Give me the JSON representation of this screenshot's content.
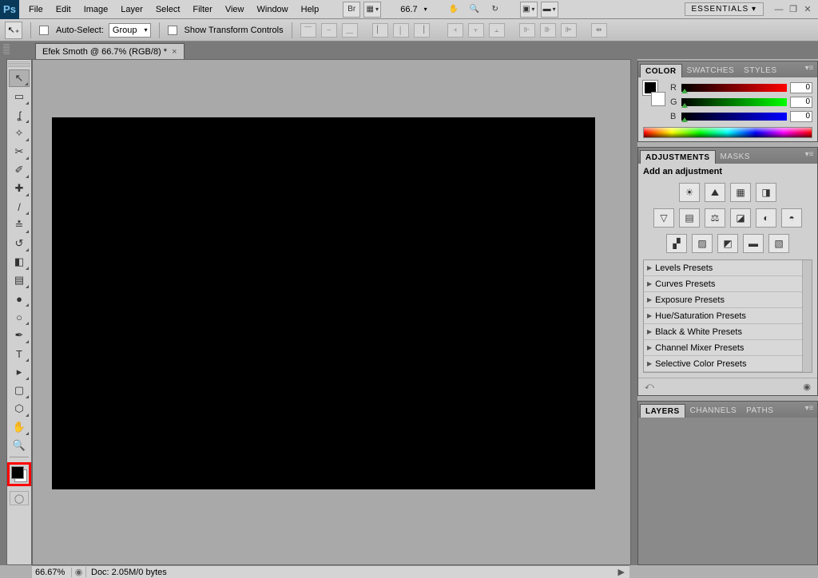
{
  "menubar": {
    "logo": "Ps",
    "items": [
      "File",
      "Edit",
      "Image",
      "Layer",
      "Select",
      "Filter",
      "View",
      "Window",
      "Help"
    ],
    "zoom_display": "66.7",
    "workspace_label": "ESSENTIALS ▾"
  },
  "options": {
    "auto_select_label": "Auto-Select:",
    "auto_select_value": "Group",
    "show_transform_label": "Show Transform Controls"
  },
  "document": {
    "tab_title": "Efek Smoth @ 66.7% (RGB/8) *"
  },
  "color_panel": {
    "tabs": [
      "COLOR",
      "SWATCHES",
      "STYLES"
    ],
    "channels": [
      {
        "label": "R",
        "value": "0",
        "track": "red"
      },
      {
        "label": "G",
        "value": "0",
        "track": "green"
      },
      {
        "label": "B",
        "value": "0",
        "track": "blue"
      }
    ]
  },
  "adjustments_panel": {
    "tabs": [
      "ADJUSTMENTS",
      "MASKS"
    ],
    "title": "Add an adjustment",
    "presets": [
      "Levels Presets",
      "Curves Presets",
      "Exposure Presets",
      "Hue/Saturation Presets",
      "Black & White Presets",
      "Channel Mixer Presets",
      "Selective Color Presets"
    ]
  },
  "layers_panel": {
    "tabs": [
      "LAYERS",
      "CHANNELS",
      "PATHS"
    ]
  },
  "status": {
    "zoom": "66.67%",
    "doc_info": "Doc: 2.05M/0 bytes"
  },
  "tools": [
    {
      "name": "move-tool",
      "glyph": "↖",
      "selected": true,
      "sub": true
    },
    {
      "name": "marquee-tool",
      "glyph": "▭",
      "sub": true
    },
    {
      "name": "lasso-tool",
      "glyph": "ʆ",
      "sub": true
    },
    {
      "name": "quick-select-tool",
      "glyph": "✧",
      "sub": true
    },
    {
      "name": "crop-tool",
      "glyph": "✂",
      "sub": true
    },
    {
      "name": "eyedropper-tool",
      "glyph": "✐",
      "sub": true
    },
    {
      "name": "healing-tool",
      "glyph": "✚",
      "sub": true
    },
    {
      "name": "brush-tool",
      "glyph": "/",
      "sub": true
    },
    {
      "name": "clone-stamp-tool",
      "glyph": "≛",
      "sub": true
    },
    {
      "name": "history-brush-tool",
      "glyph": "↺",
      "sub": true
    },
    {
      "name": "eraser-tool",
      "glyph": "◧",
      "sub": true
    },
    {
      "name": "gradient-tool",
      "glyph": "▤",
      "sub": true
    },
    {
      "name": "blur-tool",
      "glyph": "●",
      "sub": true
    },
    {
      "name": "dodge-tool",
      "glyph": "○",
      "sub": true
    },
    {
      "name": "pen-tool",
      "glyph": "✒",
      "sub": true
    },
    {
      "name": "type-tool",
      "glyph": "T",
      "sub": true
    },
    {
      "name": "path-select-tool",
      "glyph": "▸",
      "sub": true
    },
    {
      "name": "shape-tool",
      "glyph": "▢",
      "sub": true
    },
    {
      "name": "3d-tool",
      "glyph": "⬡",
      "sub": true
    },
    {
      "name": "hand-tool",
      "glyph": "✋",
      "sub": true
    },
    {
      "name": "zoom-tool",
      "glyph": "🔍",
      "sub": false
    }
  ]
}
